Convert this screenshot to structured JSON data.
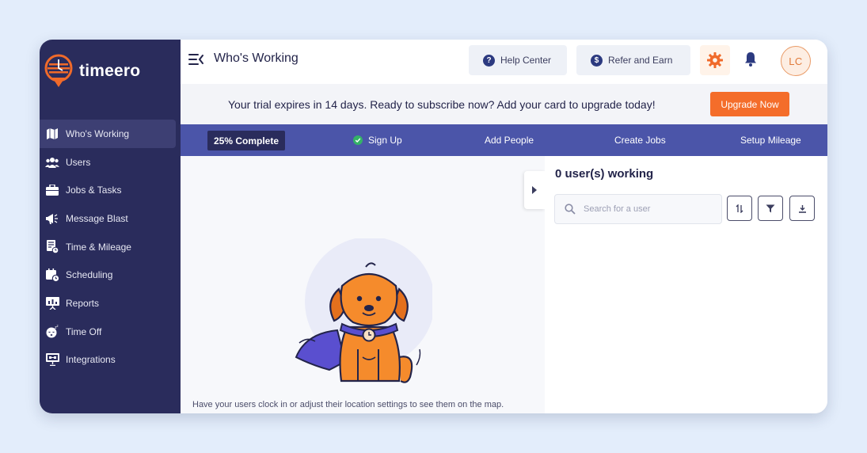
{
  "app": {
    "logo_text": "timeero"
  },
  "sidebar": {
    "items": [
      {
        "label": "Who's Working",
        "icon": "map-icon",
        "active": true
      },
      {
        "label": "Users",
        "icon": "users-icon"
      },
      {
        "label": "Jobs & Tasks",
        "icon": "briefcase-icon"
      },
      {
        "label": "Message Blast",
        "icon": "megaphone-icon"
      },
      {
        "label": "Time & Mileage",
        "icon": "timesheet-icon"
      },
      {
        "label": "Scheduling",
        "icon": "calendar-clock-icon"
      },
      {
        "label": "Reports",
        "icon": "chart-icon"
      },
      {
        "label": "Time Off",
        "icon": "sleep-icon"
      },
      {
        "label": "Integrations",
        "icon": "integrations-icon"
      }
    ]
  },
  "header": {
    "title": "Who's Working",
    "help_label": "Help Center",
    "refer_label": "Refer and Earn",
    "avatar_initials": "LC"
  },
  "trial": {
    "message": "Your trial expires in 14 days. Ready to subscribe now? Add your card to upgrade today!",
    "upgrade_label": "Upgrade Now"
  },
  "onboarding": {
    "progress_label": "25% Complete",
    "progress_percent": 25,
    "steps": [
      {
        "label": "Sign Up",
        "done": true
      },
      {
        "label": "Add People",
        "done": false
      },
      {
        "label": "Create Jobs",
        "done": false
      },
      {
        "label": "Setup Mileage",
        "done": false
      }
    ]
  },
  "map": {
    "empty_message": "Have your users clock in or adjust their location settings to see them on the map."
  },
  "panel": {
    "count_label": "0 user(s) working",
    "search_placeholder": "Search for a user"
  },
  "colors": {
    "sidebar_bg": "#2a2c5c",
    "steps_bg": "#4b55a9",
    "accent_orange": "#f46d2a",
    "success_green": "#34b367"
  }
}
